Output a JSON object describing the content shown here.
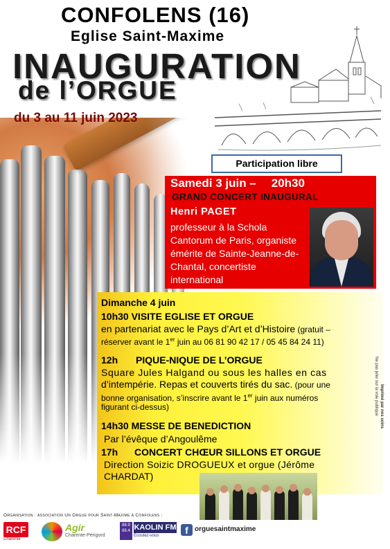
{
  "header": {
    "city": "CONFOLENS (16)",
    "church": "Eglise Saint-Maxime",
    "title": "INAUGURATION",
    "subtitle": "de l’ORGUE",
    "dates": "du 3 au 11 juin 2023"
  },
  "participation": "Participation libre",
  "saturday": {
    "day": "Samedi 3 juin –",
    "time": "20h30",
    "event": "GRAND CONCERT INAUGURAL",
    "performer": "Henri PAGET",
    "bio": "professeur à la Schola Cantorum de Paris, organiste émérite de Sainte-Jeanne-de-Chantal, concertiste international"
  },
  "sunday": {
    "day": "Dimanche 4 juin",
    "visit": {
      "time": "10h30",
      "title": "VISITE EGLISE ET ORGUE",
      "line1_main": "en partenariat avec le Pays d’Art et d’Histoire",
      "line1_note": " (gratuit –",
      "line2_a": "réserver avant le 1",
      "line2_sup": "er",
      "line2_b": " juin au 06 81 90 42 17 / 05 45 84 24 11)"
    },
    "picnic": {
      "time": "12h",
      "title": "PIQUE-NIQUE DE L’ORGUE",
      "line1": "Square Jules Halgand ou sous les halles en cas",
      "line2_main": "d’intempérie. Repas et couverts tirés du sac.",
      "line2_note": " (pour une",
      "line3_a": "bonne organisation, s’inscrire avant le 1",
      "line3_sup": "er",
      "line3_b": " juin aux numéros",
      "line4": "figurant ci-dessus)"
    },
    "mass": {
      "time": "14h30",
      "title": "MESSE DE BENEDICTION",
      "line1": "Par l’évêque d’Angoulême"
    },
    "concert": {
      "time": "17h",
      "title": "CONCERT CHŒUR SILLONS ET ORGUE",
      "line1": "Direction Soizic DROGUEUX et orgue (Jérôme",
      "line2": "CHARDAT)"
    }
  },
  "side_notes": {
    "credit1": "Ne pas jeter sur la voie publique",
    "credit2": "Imprimé par nos soins"
  },
  "footer": {
    "organisation": "Organisation : association Un Orgue pour Saint-Maxime à Confolens :",
    "rcf_label": "RCF",
    "rcf_sub": "Charente",
    "agir_label": "Agir",
    "agir_sub": "Charente-Périgord",
    "kaolin_label": "KAOLIN FM",
    "kaolin_freq": "88.9 88.4",
    "kaolin_tag": "Écoutez-vous",
    "facebook_handle": "orguesaintmaxime"
  }
}
